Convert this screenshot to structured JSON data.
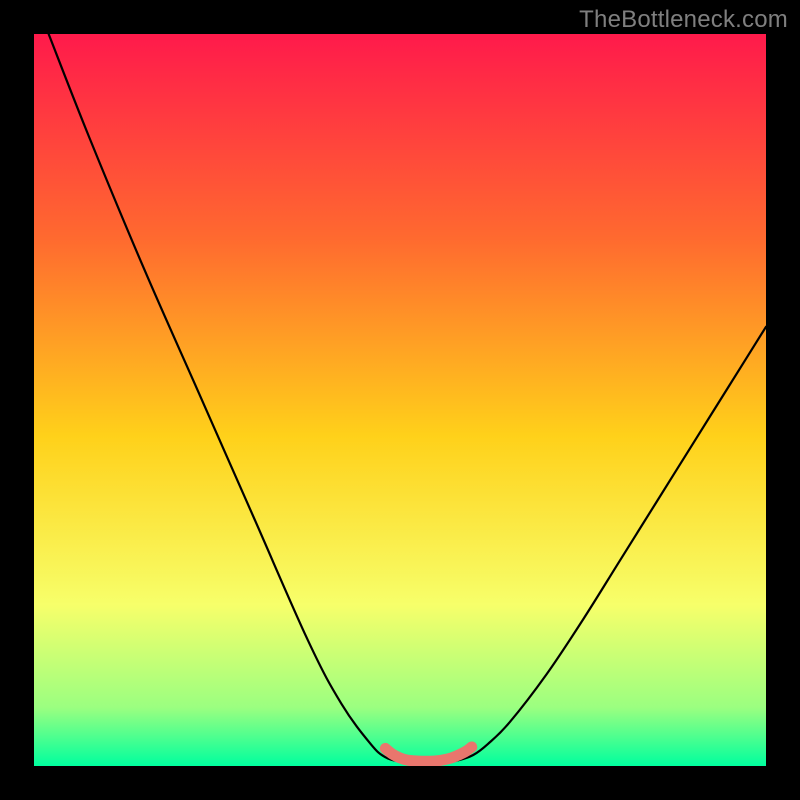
{
  "attribution": "TheBottleneck.com",
  "colors": {
    "frame": "#000000",
    "grad_top": "#ff1a4b",
    "grad_mid_upper": "#ff6a2f",
    "grad_mid": "#ffd11a",
    "grad_lower": "#f7ff6a",
    "grad_near_bottom": "#9bff80",
    "grad_bottom": "#00ff9e",
    "curve": "#000000",
    "highlight": "#e9766d"
  },
  "chart_data": {
    "type": "line",
    "title": "",
    "xlabel": "",
    "ylabel": "",
    "xlim": [
      0,
      100
    ],
    "ylim": [
      0,
      100
    ],
    "grid": false,
    "series": [
      {
        "name": "bottleneck-curve",
        "x": [
          2,
          7.5,
          15,
          22.5,
          30,
          37.5,
          42,
          46,
          48,
          50,
          52,
          54,
          56,
          58,
          60,
          62,
          65,
          70,
          75,
          80,
          85,
          90,
          95,
          100
        ],
        "y": [
          100,
          86,
          68,
          51,
          34,
          17,
          8.5,
          3,
          1.2,
          0.6,
          0.4,
          0.4,
          0.5,
          0.8,
          1.5,
          3,
          6,
          12.5,
          20,
          28,
          36,
          44,
          52,
          60
        ]
      },
      {
        "name": "highlight-band",
        "x": [
          48,
          49,
          50,
          51,
          52,
          53,
          54,
          55,
          56,
          57,
          58,
          59,
          59.8
        ],
        "y": [
          2.4,
          1.6,
          1.1,
          0.8,
          0.7,
          0.65,
          0.65,
          0.7,
          0.85,
          1.1,
          1.5,
          2.0,
          2.6
        ]
      }
    ]
  }
}
